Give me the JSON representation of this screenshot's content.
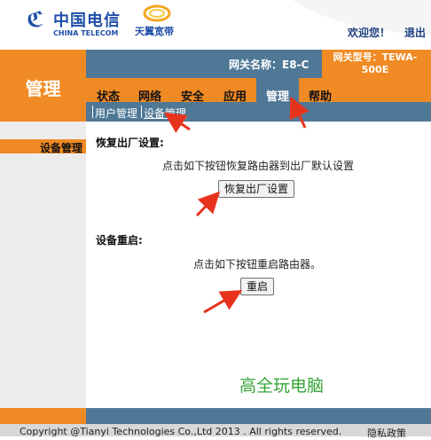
{
  "header": {
    "brand_cn": "中国电信",
    "brand_en": "CHINA TELECOM",
    "sub_brand": "天翼宽带",
    "welcome": "欢迎您！",
    "logout": "退出"
  },
  "left_title": "管理",
  "info": {
    "gateway_name": "网关名称：E8-C",
    "gateway_type": "网关型号：TEWA-500E"
  },
  "tabs": [
    {
      "label": "状态"
    },
    {
      "label": "网络"
    },
    {
      "label": "安全"
    },
    {
      "label": "应用"
    },
    {
      "label": "管理",
      "active": true
    },
    {
      "label": "帮助"
    }
  ],
  "subnav": [
    {
      "label": "用户管理"
    },
    {
      "label": "设备管理",
      "active": true
    }
  ],
  "sidebar": {
    "items": [
      {
        "label": "设备管理",
        "active": true
      }
    ]
  },
  "main": {
    "reset": {
      "title": "恢复出厂设置:",
      "desc": "点击如下按钮恢复路由器到出厂默认设置",
      "button": "恢复出厂设置"
    },
    "reboot": {
      "title": "设备重启:",
      "desc": "点击如下按钮重启路由器。",
      "button": "重启"
    }
  },
  "watermark": "高全玩电脑",
  "footer": {
    "copyright": "Copyright @Tianyi Technologies Co.,Ltd 2013 . All rights reserved.",
    "privacy": "隐私政策"
  },
  "colors": {
    "orange": "#f08a24",
    "steel_blue": "#4f7896",
    "brand_blue": "#1f4fa8",
    "annotation_red": "#e8331c",
    "watermark_green": "#36a436"
  }
}
